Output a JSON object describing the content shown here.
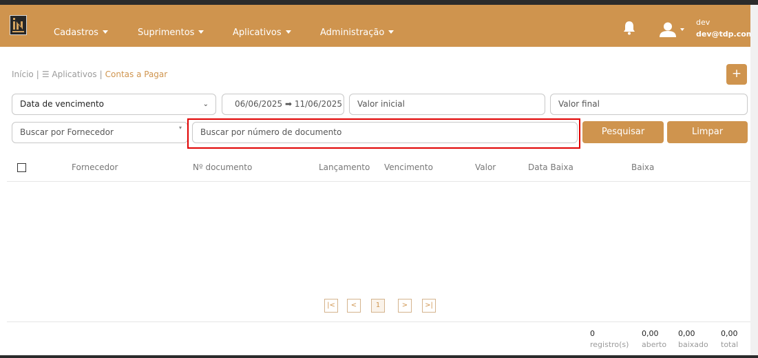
{
  "navbar": {
    "menus": [
      {
        "label": "Cadastros"
      },
      {
        "label": "Suprimentos"
      },
      {
        "label": "Aplicativos"
      },
      {
        "label": "Administração"
      }
    ],
    "user": {
      "name": "dev",
      "email": "dev@tdp.com.br"
    }
  },
  "breadcrumb": {
    "home": "Início",
    "apps": "Aplicativos",
    "current": "Contas a Pagar"
  },
  "add_button": {
    "label": "+"
  },
  "filters": {
    "date_type": {
      "value": "Data de vencimento"
    },
    "date_range": {
      "value": "06/06/2025 ➡ 11/06/2025"
    },
    "valor_inicial": {
      "placeholder": "Valor inicial"
    },
    "valor_final": {
      "placeholder": "Valor final"
    },
    "fornecedor": {
      "placeholder": "Buscar por Fornecedor"
    },
    "documento": {
      "placeholder": "Buscar por número de documento"
    },
    "search_button": "Pesquisar",
    "clear_button": "Limpar"
  },
  "table": {
    "columns": [
      "Fornecedor",
      "Nº documento",
      "Lançamento",
      "Vencimento",
      "Valor",
      "Data Baixa",
      "Baixa"
    ]
  },
  "pagination": {
    "first": "|<",
    "prev": "<",
    "current": "1",
    "next": ">",
    "last": ">|"
  },
  "summary": [
    {
      "value": "0",
      "label": "registro(s)"
    },
    {
      "value": "0,00",
      "label": "aberto"
    },
    {
      "value": "0,00",
      "label": "baixado"
    },
    {
      "value": "0,00",
      "label": "total"
    }
  ],
  "colors": {
    "accent": "#cf944e",
    "highlight": "#e00000"
  }
}
